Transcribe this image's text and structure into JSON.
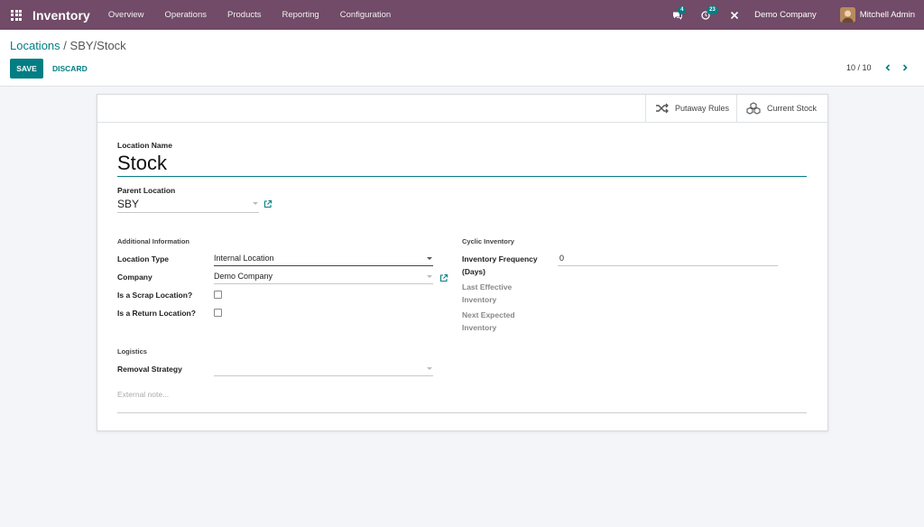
{
  "navbar": {
    "brand": "Inventory",
    "menu": [
      "Overview",
      "Operations",
      "Products",
      "Reporting",
      "Configuration"
    ],
    "messages_count": "4",
    "activities_count": "23",
    "company": "Demo Company",
    "user": "Mitchell Admin",
    "background_color": "#714b67"
  },
  "control": {
    "breadcrumb_link": "Locations",
    "breadcrumb_sep": "/",
    "breadcrumb_current": "SBY/Stock",
    "save_label": "SAVE",
    "discard_label": "DISCARD",
    "pager": "10 / 10",
    "accent_color": "#017e84"
  },
  "smart_buttons": {
    "putaway": "Putaway Rules",
    "current_stock": "Current Stock"
  },
  "form": {
    "location_name_label": "Location Name",
    "location_name": "Stock",
    "parent_location_label": "Parent Location",
    "parent_location": "SBY",
    "additional_info_title": "Additional Information",
    "location_type_label": "Location Type",
    "location_type": "Internal Location",
    "company_label": "Company",
    "company": "Demo Company",
    "scrap_label": "Is a Scrap Location?",
    "scrap_checked": false,
    "return_label": "Is a Return Location?",
    "return_checked": false,
    "cyclic_title": "Cyclic Inventory",
    "inv_freq_label_1": "Inventory Frequency",
    "inv_freq_label_2": "(Days)",
    "inv_freq": "0",
    "last_eff_label_1": "Last Effective",
    "last_eff_label_2": "Inventory",
    "next_exp_label_1": "Next Expected",
    "next_exp_label_2": "Inventory",
    "logistics_title": "Logistics",
    "removal_label": "Removal Strategy",
    "removal_value": "",
    "note_placeholder": "External note..."
  }
}
